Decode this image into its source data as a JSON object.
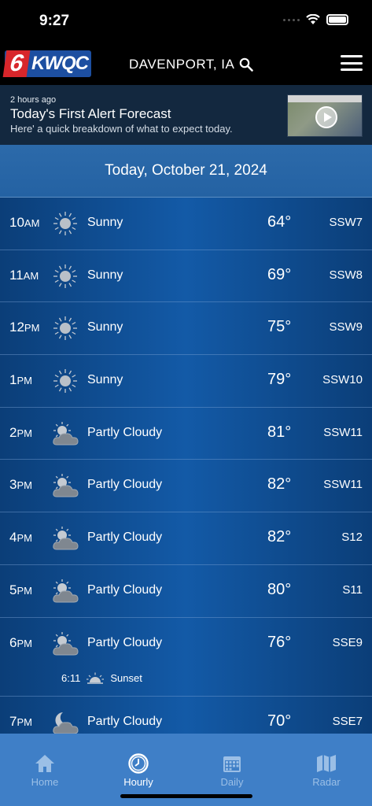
{
  "status": {
    "time": "9:27"
  },
  "header": {
    "logo_number": "6",
    "logo_text": "KWQC",
    "location": "DAVENPORT, IA"
  },
  "promo": {
    "time_ago": "2 hours ago",
    "title": "Today's First Alert Forecast",
    "subtitle": "Here' a quick breakdown of what to expect today."
  },
  "forecast": {
    "date": "Today, October 21, 2024",
    "hours": [
      {
        "hour": "10",
        "ampm": "AM",
        "icon": "sun-icon",
        "condition": "Sunny",
        "temp": "64°",
        "wind": "SSW7"
      },
      {
        "hour": "11",
        "ampm": "AM",
        "icon": "sun-icon",
        "condition": "Sunny",
        "temp": "69°",
        "wind": "SSW8"
      },
      {
        "hour": "12",
        "ampm": "PM",
        "icon": "sun-icon",
        "condition": "Sunny",
        "temp": "75°",
        "wind": "SSW9"
      },
      {
        "hour": "1",
        "ampm": "PM",
        "icon": "sun-icon",
        "condition": "Sunny",
        "temp": "79°",
        "wind": "SSW10"
      },
      {
        "hour": "2",
        "ampm": "PM",
        "icon": "partly-cloudy-icon",
        "condition": "Partly Cloudy",
        "temp": "81°",
        "wind": "SSW11"
      },
      {
        "hour": "3",
        "ampm": "PM",
        "icon": "partly-cloudy-icon",
        "condition": "Partly Cloudy",
        "temp": "82°",
        "wind": "SSW11"
      },
      {
        "hour": "4",
        "ampm": "PM",
        "icon": "partly-cloudy-icon",
        "condition": "Partly Cloudy",
        "temp": "82°",
        "wind": "S12"
      },
      {
        "hour": "5",
        "ampm": "PM",
        "icon": "partly-cloudy-icon",
        "condition": "Partly Cloudy",
        "temp": "80°",
        "wind": "S11"
      },
      {
        "hour": "6",
        "ampm": "PM",
        "icon": "partly-cloudy-icon",
        "condition": "Partly Cloudy",
        "temp": "76°",
        "wind": "SSE9"
      },
      {
        "hour": "7",
        "ampm": "PM",
        "icon": "partly-cloudy-night-icon",
        "condition": "Partly Cloudy",
        "temp": "70°",
        "wind": "SSE7"
      }
    ],
    "sunset": {
      "time": "6:11",
      "label": "Sunset"
    }
  },
  "tabs": [
    {
      "label": "Home",
      "icon": "home-icon"
    },
    {
      "label": "Hourly",
      "icon": "clock-icon"
    },
    {
      "label": "Daily",
      "icon": "calendar-icon"
    },
    {
      "label": "Radar",
      "icon": "map-icon"
    }
  ]
}
